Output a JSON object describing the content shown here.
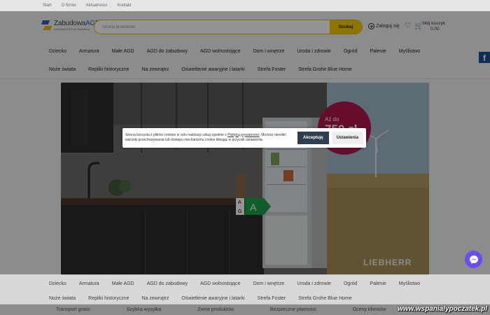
{
  "topbar": {
    "links": [
      "Start",
      "O firmie",
      "Aktualności",
      "Kontakt"
    ]
  },
  "logo": {
    "name_part1": "Zabudowa",
    "name_part2": "AGD",
    "tagline": "wszystkie AGD do zabudowy"
  },
  "search": {
    "placeholder": "Szukaj produktów",
    "button_label": "Szukaj"
  },
  "account": {
    "login_label": "Zaloguj się"
  },
  "cart": {
    "label": "Mój koszyk",
    "amount": "0,00"
  },
  "nav": {
    "row1": [
      "Dziecko",
      "Armatura",
      "Małe AGD",
      "AGD do zabudowy",
      "AGD wolnostojące",
      "Dom i wnętrze",
      "Uroda i zdrowie",
      "Ogród",
      "Palenie",
      "Myślistwo"
    ],
    "row2": [
      "Noże świata",
      "Repliki historyczne",
      "Na zewnątrz",
      "Oświetlenie awaryjne i latarki",
      "Strefa Foster",
      "Strefa Grohe Blue Home"
    ]
  },
  "banner": {
    "promo_small": "Aż do",
    "promo_big": "750 zł",
    "energy_class": "A",
    "energy_scale_top": "A",
    "energy_scale_bottom": "G",
    "brand": "LIEBHERR"
  },
  "cookie": {
    "text_before": "Strona korzysta z plików cookies w celu realizacji usług zgodnie z ",
    "policy_link": "Polityką prywatności",
    "text_after": ". Możesz określić warunki przechowywania lub dostępu mechanizmu cookie klikając w przycisk ustawienia.",
    "accept_label": "Akceptuję",
    "settings_label": "Ustawienia"
  },
  "benefits": [
    "Transport gratis",
    "Szybka wysyłka",
    "Zwrot produktów",
    "Bezpieczne płatności",
    "Oceny klientów"
  ],
  "watermark": "www.wspanialypoczatek.pl",
  "colors": {
    "accent": "#f6c800",
    "brand_blue": "#2a62b6",
    "accept_button": "#2c3e50",
    "messenger": "#6a4cf0",
    "promo": "#b0174f"
  }
}
